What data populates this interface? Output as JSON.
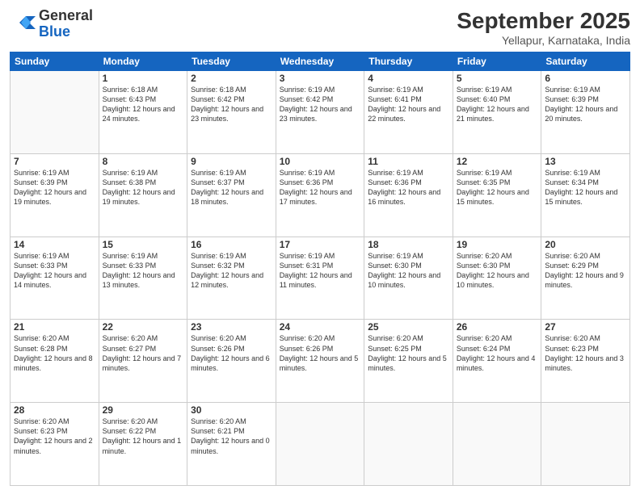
{
  "header": {
    "logo_general": "General",
    "logo_blue": "Blue",
    "month_title": "September 2025",
    "location": "Yellapur, Karnataka, India"
  },
  "days_of_week": [
    "Sunday",
    "Monday",
    "Tuesday",
    "Wednesday",
    "Thursday",
    "Friday",
    "Saturday"
  ],
  "weeks": [
    [
      {
        "day": null
      },
      {
        "day": "1",
        "sunrise": "6:18 AM",
        "sunset": "6:43 PM",
        "daylight": "12 hours and 24 minutes."
      },
      {
        "day": "2",
        "sunrise": "6:18 AM",
        "sunset": "6:42 PM",
        "daylight": "12 hours and 23 minutes."
      },
      {
        "day": "3",
        "sunrise": "6:19 AM",
        "sunset": "6:42 PM",
        "daylight": "12 hours and 23 minutes."
      },
      {
        "day": "4",
        "sunrise": "6:19 AM",
        "sunset": "6:41 PM",
        "daylight": "12 hours and 22 minutes."
      },
      {
        "day": "5",
        "sunrise": "6:19 AM",
        "sunset": "6:40 PM",
        "daylight": "12 hours and 21 minutes."
      },
      {
        "day": "6",
        "sunrise": "6:19 AM",
        "sunset": "6:39 PM",
        "daylight": "12 hours and 20 minutes."
      }
    ],
    [
      {
        "day": "7",
        "sunrise": "6:19 AM",
        "sunset": "6:39 PM",
        "daylight": "12 hours and 19 minutes."
      },
      {
        "day": "8",
        "sunrise": "6:19 AM",
        "sunset": "6:38 PM",
        "daylight": "12 hours and 19 minutes."
      },
      {
        "day": "9",
        "sunrise": "6:19 AM",
        "sunset": "6:37 PM",
        "daylight": "12 hours and 18 minutes."
      },
      {
        "day": "10",
        "sunrise": "6:19 AM",
        "sunset": "6:36 PM",
        "daylight": "12 hours and 17 minutes."
      },
      {
        "day": "11",
        "sunrise": "6:19 AM",
        "sunset": "6:36 PM",
        "daylight": "12 hours and 16 minutes."
      },
      {
        "day": "12",
        "sunrise": "6:19 AM",
        "sunset": "6:35 PM",
        "daylight": "12 hours and 15 minutes."
      },
      {
        "day": "13",
        "sunrise": "6:19 AM",
        "sunset": "6:34 PM",
        "daylight": "12 hours and 15 minutes."
      }
    ],
    [
      {
        "day": "14",
        "sunrise": "6:19 AM",
        "sunset": "6:33 PM",
        "daylight": "12 hours and 14 minutes."
      },
      {
        "day": "15",
        "sunrise": "6:19 AM",
        "sunset": "6:33 PM",
        "daylight": "12 hours and 13 minutes."
      },
      {
        "day": "16",
        "sunrise": "6:19 AM",
        "sunset": "6:32 PM",
        "daylight": "12 hours and 12 minutes."
      },
      {
        "day": "17",
        "sunrise": "6:19 AM",
        "sunset": "6:31 PM",
        "daylight": "12 hours and 11 minutes."
      },
      {
        "day": "18",
        "sunrise": "6:19 AM",
        "sunset": "6:30 PM",
        "daylight": "12 hours and 10 minutes."
      },
      {
        "day": "19",
        "sunrise": "6:20 AM",
        "sunset": "6:30 PM",
        "daylight": "12 hours and 10 minutes."
      },
      {
        "day": "20",
        "sunrise": "6:20 AM",
        "sunset": "6:29 PM",
        "daylight": "12 hours and 9 minutes."
      }
    ],
    [
      {
        "day": "21",
        "sunrise": "6:20 AM",
        "sunset": "6:28 PM",
        "daylight": "12 hours and 8 minutes."
      },
      {
        "day": "22",
        "sunrise": "6:20 AM",
        "sunset": "6:27 PM",
        "daylight": "12 hours and 7 minutes."
      },
      {
        "day": "23",
        "sunrise": "6:20 AM",
        "sunset": "6:26 PM",
        "daylight": "12 hours and 6 minutes."
      },
      {
        "day": "24",
        "sunrise": "6:20 AM",
        "sunset": "6:26 PM",
        "daylight": "12 hours and 5 minutes."
      },
      {
        "day": "25",
        "sunrise": "6:20 AM",
        "sunset": "6:25 PM",
        "daylight": "12 hours and 5 minutes."
      },
      {
        "day": "26",
        "sunrise": "6:20 AM",
        "sunset": "6:24 PM",
        "daylight": "12 hours and 4 minutes."
      },
      {
        "day": "27",
        "sunrise": "6:20 AM",
        "sunset": "6:23 PM",
        "daylight": "12 hours and 3 minutes."
      }
    ],
    [
      {
        "day": "28",
        "sunrise": "6:20 AM",
        "sunset": "6:23 PM",
        "daylight": "12 hours and 2 minutes."
      },
      {
        "day": "29",
        "sunrise": "6:20 AM",
        "sunset": "6:22 PM",
        "daylight": "12 hours and 1 minute."
      },
      {
        "day": "30",
        "sunrise": "6:20 AM",
        "sunset": "6:21 PM",
        "daylight": "12 hours and 0 minutes."
      },
      {
        "day": null
      },
      {
        "day": null
      },
      {
        "day": null
      },
      {
        "day": null
      }
    ]
  ],
  "labels": {
    "sunrise": "Sunrise:",
    "sunset": "Sunset:",
    "daylight": "Daylight:"
  }
}
